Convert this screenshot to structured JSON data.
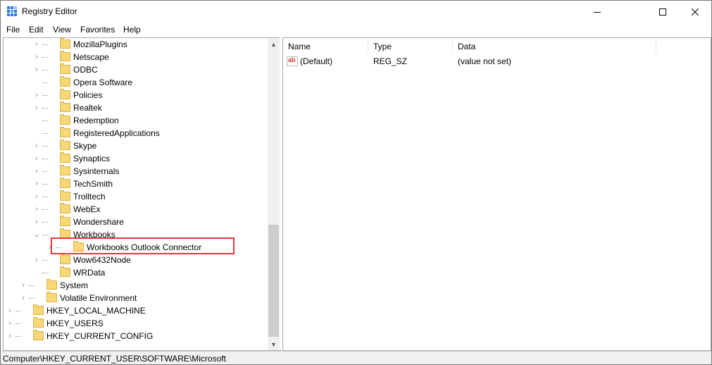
{
  "window": {
    "title": "Registry Editor",
    "controls": {
      "minimize": "—",
      "maximize": "☐",
      "close": "✕"
    }
  },
  "menu": [
    "File",
    "Edit",
    "View",
    "Favorites",
    "Help"
  ],
  "tree": [
    {
      "label": "MozillaPlugins",
      "level": 3,
      "expander": "collapsed"
    },
    {
      "label": "Netscape",
      "level": 3,
      "expander": "collapsed"
    },
    {
      "label": "ODBC",
      "level": 3,
      "expander": "collapsed"
    },
    {
      "label": "Opera Software",
      "level": 3,
      "expander": "none"
    },
    {
      "label": "Policies",
      "level": 3,
      "expander": "collapsed"
    },
    {
      "label": "Realtek",
      "level": 3,
      "expander": "collapsed"
    },
    {
      "label": "Redemption",
      "level": 3,
      "expander": "none"
    },
    {
      "label": "RegisteredApplications",
      "level": 3,
      "expander": "none"
    },
    {
      "label": "Skype",
      "level": 3,
      "expander": "collapsed"
    },
    {
      "label": "Synaptics",
      "level": 3,
      "expander": "collapsed"
    },
    {
      "label": "Sysinternals",
      "level": 3,
      "expander": "collapsed"
    },
    {
      "label": "TechSmith",
      "level": 3,
      "expander": "collapsed"
    },
    {
      "label": "Trolltech",
      "level": 3,
      "expander": "collapsed"
    },
    {
      "label": "WebEx",
      "level": 3,
      "expander": "collapsed"
    },
    {
      "label": "Wondershare",
      "level": 3,
      "expander": "collapsed"
    },
    {
      "label": "Workbooks",
      "level": 3,
      "expander": "expanded"
    },
    {
      "label": "Workbooks Outlook Connector",
      "level": 4,
      "expander": "collapsed"
    },
    {
      "label": "Wow6432Node",
      "level": 3,
      "expander": "collapsed"
    },
    {
      "label": "WRData",
      "level": 3,
      "expander": "none"
    },
    {
      "label": "System",
      "level": 2,
      "expander": "collapsed"
    },
    {
      "label": "Volatile Environment",
      "level": 2,
      "expander": "collapsed"
    },
    {
      "label": "HKEY_LOCAL_MACHINE",
      "level": 1,
      "expander": "collapsed"
    },
    {
      "label": "HKEY_USERS",
      "level": 1,
      "expander": "collapsed"
    },
    {
      "label": "HKEY_CURRENT_CONFIG",
      "level": 1,
      "expander": "collapsed"
    }
  ],
  "list": {
    "columns": [
      "Name",
      "Type",
      "Data"
    ],
    "rows": [
      {
        "icon": "ab",
        "name": "(Default)",
        "type": "REG_SZ",
        "data": "(value not set)"
      }
    ]
  },
  "statusbar": {
    "path": "Computer\\HKEY_CURRENT_USER\\SOFTWARE\\Microsoft"
  },
  "colors": {
    "folder": "#f8d775",
    "highlight": "#e03a3a"
  },
  "scrollbar": {
    "up": "▲",
    "down": "▼"
  }
}
